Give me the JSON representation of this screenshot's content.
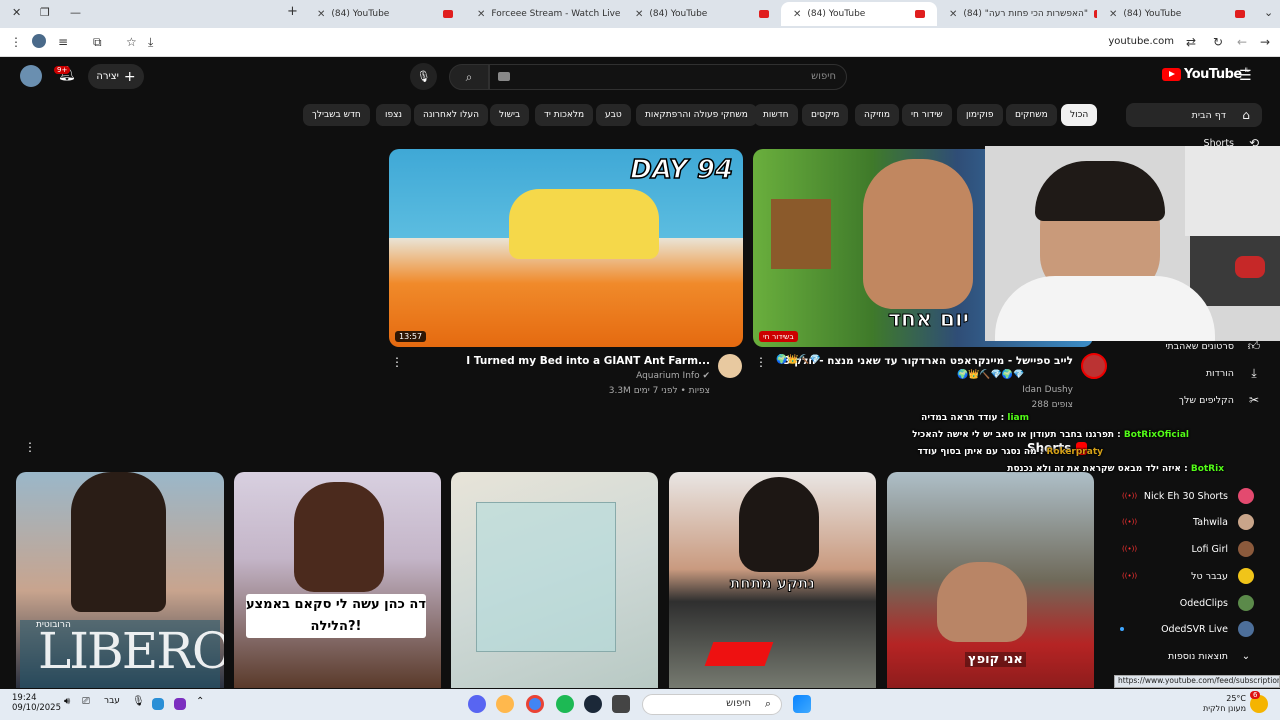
{
  "browser": {
    "tabs": [
      {
        "title": "(84) YouTube",
        "favicon": "youtube-icon"
      },
      {
        "title": "Forceee Stream - Watch Live on",
        "favicon": "kick-icon"
      },
      {
        "title": "(84) YouTube",
        "favicon": "youtube-icon"
      },
      {
        "title": "(84) YouTube",
        "favicon": "youtube-icon",
        "active": true
      },
      {
        "title": "(84) \"האפשרות הכי פחות רעה\"",
        "favicon": "youtube-icon"
      },
      {
        "title": "(84) YouTube",
        "favicon": "youtube-icon"
      }
    ],
    "url": "youtube.com",
    "status_url": "https://www.youtube.com/feed/subscriptions"
  },
  "header": {
    "logo_text": "YouTube",
    "logo_region": "IL",
    "search_placeholder": "חיפוש",
    "create_label": "יצירה",
    "notification_count": "9+"
  },
  "chips": [
    "הכול",
    "משחקים",
    "פוקימון",
    "שידור חי",
    "מוזיקה",
    "מיקסים",
    "חדשות",
    "משחקי פעולה והרפתקאות",
    "טבע",
    "מלאכות יד",
    "בישול",
    "העלו לאחרונה",
    "נצפו",
    "חדש בשבילך"
  ],
  "sidebar": {
    "main": [
      {
        "label": "דף הבית",
        "icon": "home-icon"
      },
      {
        "label": "Shorts",
        "icon": "shorts-icon"
      }
    ],
    "you": [
      {
        "label": "סרטונים שאהבתי",
        "icon": "like-icon"
      },
      {
        "label": "הורדות",
        "icon": "download-icon"
      },
      {
        "label": "הקליפים שלך",
        "icon": "scissors-icon"
      }
    ],
    "subscriptions": [
      {
        "label": "Nick Eh 30 Shorts",
        "indicator": "live"
      },
      {
        "label": "Tahwila",
        "indicator": "live"
      },
      {
        "label": "Lofi Girl",
        "indicator": "live"
      },
      {
        "label": "עבבר טל",
        "indicator": "live"
      },
      {
        "label": "OdedClips",
        "indicator": "none"
      },
      {
        "label": "OdedSVR Live",
        "indicator": "dot"
      },
      {
        "label": "תוצאות נוספות",
        "indicator": "chevron"
      }
    ]
  },
  "videos": [
    {
      "title": "I Turned my Bed into a GIANT Ant Farm...",
      "channel": "Aquarium Info",
      "meta": "3.3M צפיות • לפני 7 ימים",
      "duration": "13:57",
      "thumb_text": "DAY 94"
    },
    {
      "title": "לייב ספיישל - מיינקראפט הארדקור עד שאני מנצח - חלק 3",
      "channel": "Idan Dushy",
      "meta": "288 צופים",
      "badge": "בשידור חי",
      "thumb_text": "יום אחד"
    }
  ],
  "shorts": [
    {
      "overlay": "LIBERO",
      "label": "הרובוטית"
    },
    {
      "overlay": "דה כהן עשה לי סקאם באמצע הלילה?!"
    },
    {
      "overlay": ""
    },
    {
      "overlay": "נתקע מתחת"
    },
    {
      "overlay": "אני קופץ"
    }
  ],
  "shorts_header": "Shorts",
  "chat": [
    {
      "user": "liam",
      "text": "עודד תראה במדיה :",
      "color": "#53fc18"
    },
    {
      "user": "BotRixOficial",
      "text": "תפרגנו בחבר תעודון או סאב יש לי אישה להאכיל :",
      "color": "#53fc18"
    },
    {
      "user": "Rokerpraty",
      "text": "מה נסגר עם איתן בסוף עודד :",
      "color": "#d4a017"
    },
    {
      "user": "BotRix",
      "text": "איזה ילד מבאס שקראת את זה ולא נכנסת :",
      "color": "#53fc18"
    }
  ],
  "taskbar": {
    "time": "19:24",
    "date": "09/10/2025",
    "lang": "עבר",
    "weather": "25°C",
    "weather_desc": "מעונן חלקית",
    "search_placeholder": "חיפוש",
    "notif_badge": "6"
  }
}
